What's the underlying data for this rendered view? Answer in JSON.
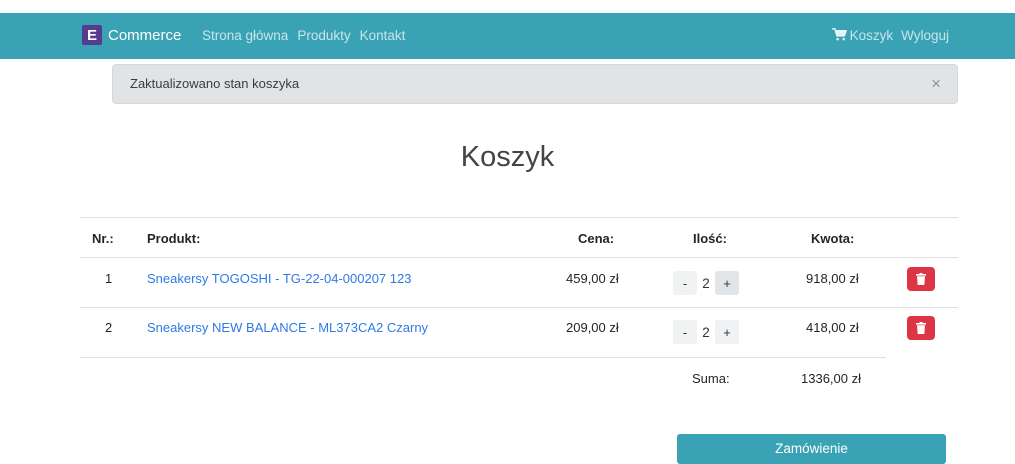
{
  "navbar": {
    "brand_letter": "E",
    "brand_text": "Commerce",
    "links": [
      "Strona główna",
      "Produkty",
      "Kontakt"
    ],
    "cart_label": "Koszyk",
    "logout_label": "Wyloguj"
  },
  "alert": {
    "message": "Zaktualizowano stan koszyka",
    "close": "×"
  },
  "page_title": "Koszyk",
  "table": {
    "headers": {
      "nr": "Nr.:",
      "product": "Produkt:",
      "price": "Cena:",
      "qty": "Ilość:",
      "amount": "Kwota:"
    },
    "rows": [
      {
        "nr": "1",
        "product": "Sneakersy TOGOSHI - TG-22-04-000207 123",
        "price": "459,00 zł",
        "minus": "-",
        "qty": "2",
        "plus": "+",
        "amount": "918,00 zł"
      },
      {
        "nr": "2",
        "product": "Sneakersy NEW BALANCE - ML373CA2 Czarny",
        "price": "209,00 zł",
        "minus": "-",
        "qty": "2",
        "plus": "+",
        "amount": "418,00 zł"
      }
    ],
    "sum_label": "Suma:",
    "sum_value": "1336,00 zł"
  },
  "order_button": "Zamówienie",
  "colors": {
    "navbar": "#3aa2b5",
    "brand_badge": "#543c8e",
    "danger": "#dc3545",
    "link": "#2f7ae8"
  }
}
